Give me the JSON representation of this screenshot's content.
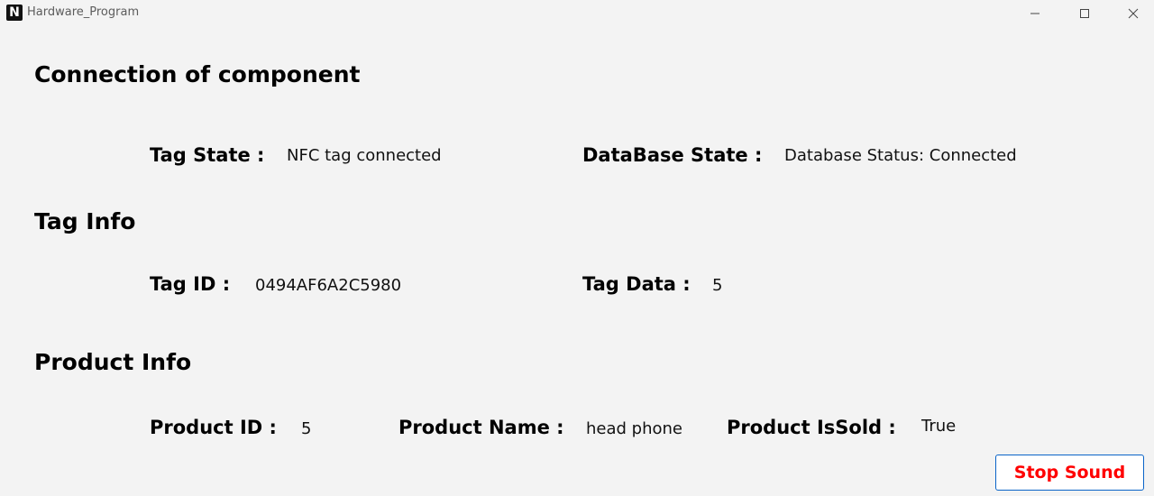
{
  "window": {
    "title": "Hardware_Program",
    "app_icon_letter": "N"
  },
  "sections": {
    "connection": {
      "heading": "Connection of component",
      "tag_state_label": "Tag State :",
      "tag_state_value": "NFC tag connected",
      "db_state_label": "DataBase State :",
      "db_state_value": "Database Status: Connected"
    },
    "tag_info": {
      "heading": "Tag Info",
      "tag_id_label": "Tag ID :",
      "tag_id_value": "0494AF6A2C5980",
      "tag_data_label": "Tag Data :",
      "tag_data_value": "5"
    },
    "product_info": {
      "heading": "Product Info",
      "product_id_label": "Product ID :",
      "product_id_value": "5",
      "product_name_label": "Product Name :",
      "product_name_value": "head phone",
      "product_issold_label": "Product IsSold :",
      "product_issold_value": "True"
    }
  },
  "actions": {
    "stop_sound_label": "Stop Sound"
  },
  "colors": {
    "background": "#f3f3f3",
    "stop_button_text": "#ff0000",
    "stop_button_border": "#0a64c8"
  }
}
